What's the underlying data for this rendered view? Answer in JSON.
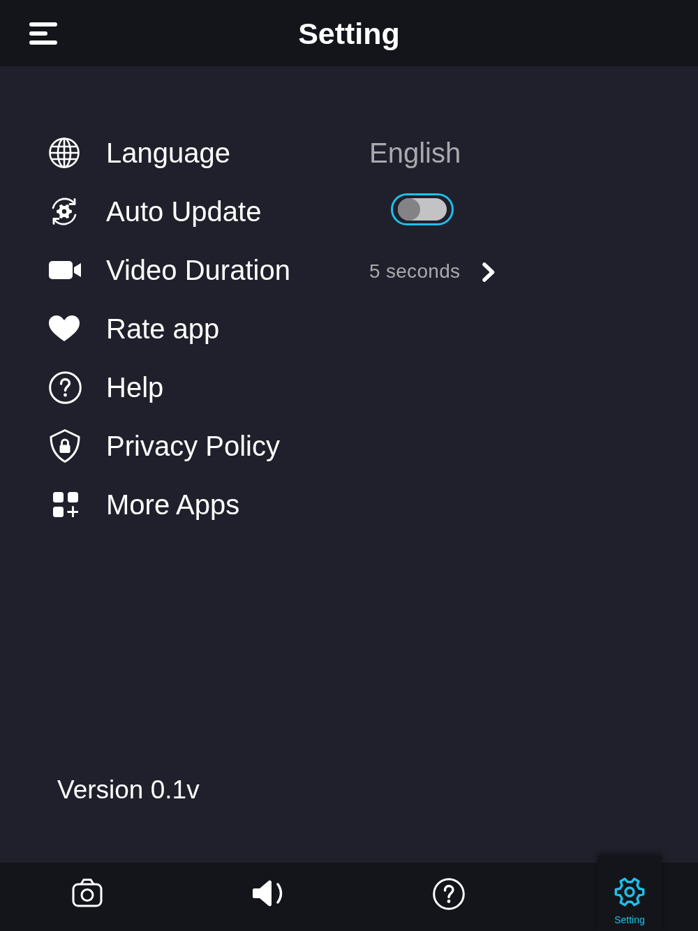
{
  "header": {
    "title": "Setting"
  },
  "settings": [
    {
      "kind": "value",
      "label": "Language",
      "value": "English"
    },
    {
      "kind": "toggle",
      "label": "Auto Update",
      "on": false
    },
    {
      "kind": "link",
      "label": "Video Duration",
      "value": "5 seconds"
    },
    {
      "kind": "plain",
      "label": "Rate app"
    },
    {
      "kind": "plain",
      "label": "Help"
    },
    {
      "kind": "plain",
      "label": "Privacy Policy"
    },
    {
      "kind": "plain",
      "label": "More Apps"
    }
  ],
  "version": "Version 0.1v",
  "tab_bar": [
    {
      "selected": false
    },
    {
      "selected": false
    },
    {
      "selected": false
    },
    {
      "selected": true,
      "label": "Setting"
    }
  ]
}
